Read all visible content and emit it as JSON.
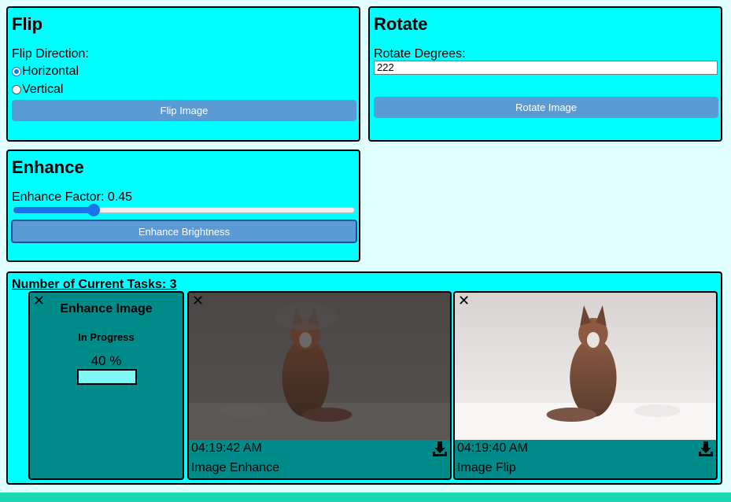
{
  "flip": {
    "title": "Flip",
    "direction_label": "Flip Direction:",
    "options": [
      "Horizontal",
      "Vertical"
    ],
    "selected": "Horizontal",
    "button_label": "Flip Image"
  },
  "rotate": {
    "title": "Rotate",
    "degrees_label": "Rotate Degrees:",
    "degrees_value": "222",
    "button_label": "Rotate Image"
  },
  "enhance": {
    "title": "Enhance",
    "factor_label": "Enhance Factor: 0.45",
    "factor_fraction": 0.235,
    "button_label": "Enhance Brightness"
  },
  "tasks": {
    "header": "Number of Current Tasks: 3",
    "in_progress": {
      "title": "Enhance Image",
      "status": "In Progress",
      "progress_text": "40 %",
      "progress_fraction": 0.4
    },
    "completed": [
      {
        "time": "04:19:42 AM",
        "type": "Image Enhance",
        "image": "dark snowy fox photo"
      },
      {
        "time": "04:19:40 AM",
        "type": "Image Flip",
        "image": "bright snowy fox photo"
      }
    ]
  },
  "colors": {
    "panel_bg": "#00ffff",
    "page_bg": "#e0fffe",
    "button_blue": "#5b9bd5",
    "task_card_bg": "#008b8b",
    "accent_blue": "#1a73e8",
    "bottom_bar": "#1ad9b0"
  },
  "icons": [
    "close-icon",
    "download-icon"
  ]
}
